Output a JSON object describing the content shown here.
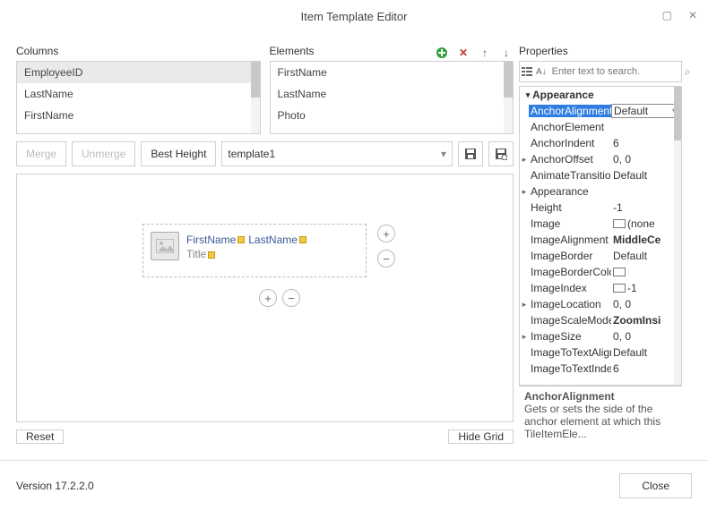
{
  "window": {
    "title": "Item Template Editor"
  },
  "labels": {
    "columns": "Columns",
    "elements": "Elements",
    "properties": "Properties"
  },
  "columns": {
    "items": [
      "EmployeeID",
      "LastName",
      "FirstName"
    ],
    "selectedIndex": 0
  },
  "elements": {
    "items": [
      "FirstName",
      "LastName",
      "Photo"
    ]
  },
  "toolbar": {
    "merge": "Merge",
    "unmerge": "Unmerge",
    "bestHeight": "Best Height",
    "template": "template1",
    "reset": "Reset",
    "hideGrid": "Hide Grid"
  },
  "tile": {
    "name1": "FirstName",
    "name2": "LastName",
    "title": "Title"
  },
  "propToolbar": {
    "searchPlaceholder": "Enter text to search."
  },
  "propCategory": "Appearance",
  "props": [
    {
      "exp": "",
      "name": "AnchorAlignment",
      "val": "Default",
      "sel": true,
      "dd": true
    },
    {
      "exp": "",
      "name": "AnchorElement",
      "val": ""
    },
    {
      "exp": "",
      "name": "AnchorIndent",
      "val": "6"
    },
    {
      "exp": "▸",
      "name": "AnchorOffset",
      "val": "0, 0"
    },
    {
      "exp": "",
      "name": "AnimateTransition",
      "val": "Default"
    },
    {
      "exp": "▸",
      "name": "Appearance",
      "val": ""
    },
    {
      "exp": "",
      "name": "Height",
      "val": "-1"
    },
    {
      "exp": "",
      "name": "Image",
      "val": "(none",
      "swatch": true
    },
    {
      "exp": "",
      "name": "ImageAlignment",
      "val": "MiddleCe",
      "bold": true
    },
    {
      "exp": "",
      "name": "ImageBorder",
      "val": "Default"
    },
    {
      "exp": "",
      "name": "ImageBorderColor",
      "val": "",
      "swatch": true
    },
    {
      "exp": "",
      "name": "ImageIndex",
      "val": "-1",
      "swatch": true
    },
    {
      "exp": "▸",
      "name": "ImageLocation",
      "val": "0, 0"
    },
    {
      "exp": "",
      "name": "ImageScaleMode",
      "val": "ZoomInsi",
      "bold": true
    },
    {
      "exp": "▸",
      "name": "ImageSize",
      "val": "0, 0"
    },
    {
      "exp": "",
      "name": "ImageToTextAlign",
      "val": "Default"
    },
    {
      "exp": "",
      "name": "ImageToTextInde",
      "val": "6"
    }
  ],
  "propDesc": {
    "name": "AnchorAlignment",
    "text": "Gets or sets the side of the anchor element at which this TileItemEle..."
  },
  "footer": {
    "version": "Version 17.2.2.0",
    "close": "Close"
  }
}
